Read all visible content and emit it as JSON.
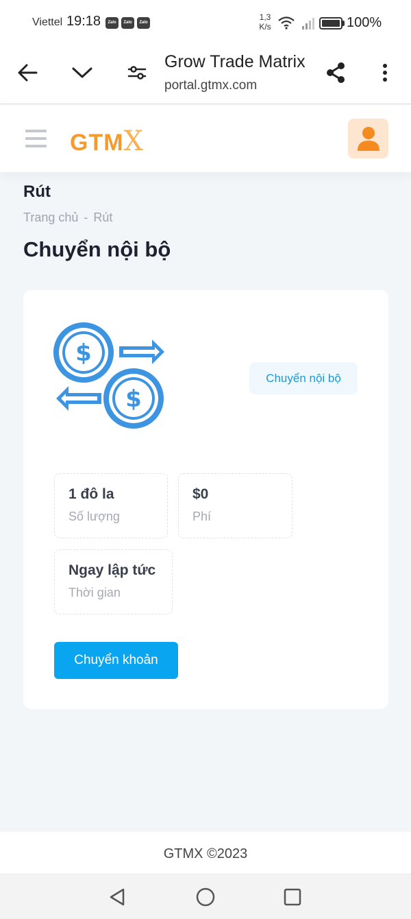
{
  "status_bar": {
    "carrier": "Viettel",
    "time": "19:18",
    "notification_icons": [
      "Zalo",
      "Zalo",
      "Zalo"
    ],
    "net_speed_value": "1,3",
    "net_speed_unit": "K/s",
    "battery": "100%"
  },
  "browser": {
    "page_title": "Grow Trade Matrix",
    "url": "portal.gtmx.com"
  },
  "header": {
    "logo_main": "GTM",
    "logo_x": "X"
  },
  "page": {
    "section_title": "Rút",
    "breadcrumb": {
      "home": "Trang chủ",
      "separator": "-",
      "current": "Rút"
    },
    "heading": "Chuyển nội bộ"
  },
  "card": {
    "type_badge": "Chuyển nội bộ",
    "amount": {
      "value": "1 đô la",
      "label": "Số lượng"
    },
    "fee": {
      "value": "$0",
      "label": "Phí"
    },
    "time": {
      "value": "Ngay lập tức",
      "label": "Thời gian"
    },
    "button_label": "Chuyển khoản"
  },
  "footer": {
    "brand": "GTMX",
    "copyright": "©2023"
  },
  "colors": {
    "brand_orange": "#f59a2c",
    "accent_blue": "#0aa5f0",
    "illustration_blue": "#3d94e0",
    "page_background": "#f3f6f9"
  }
}
